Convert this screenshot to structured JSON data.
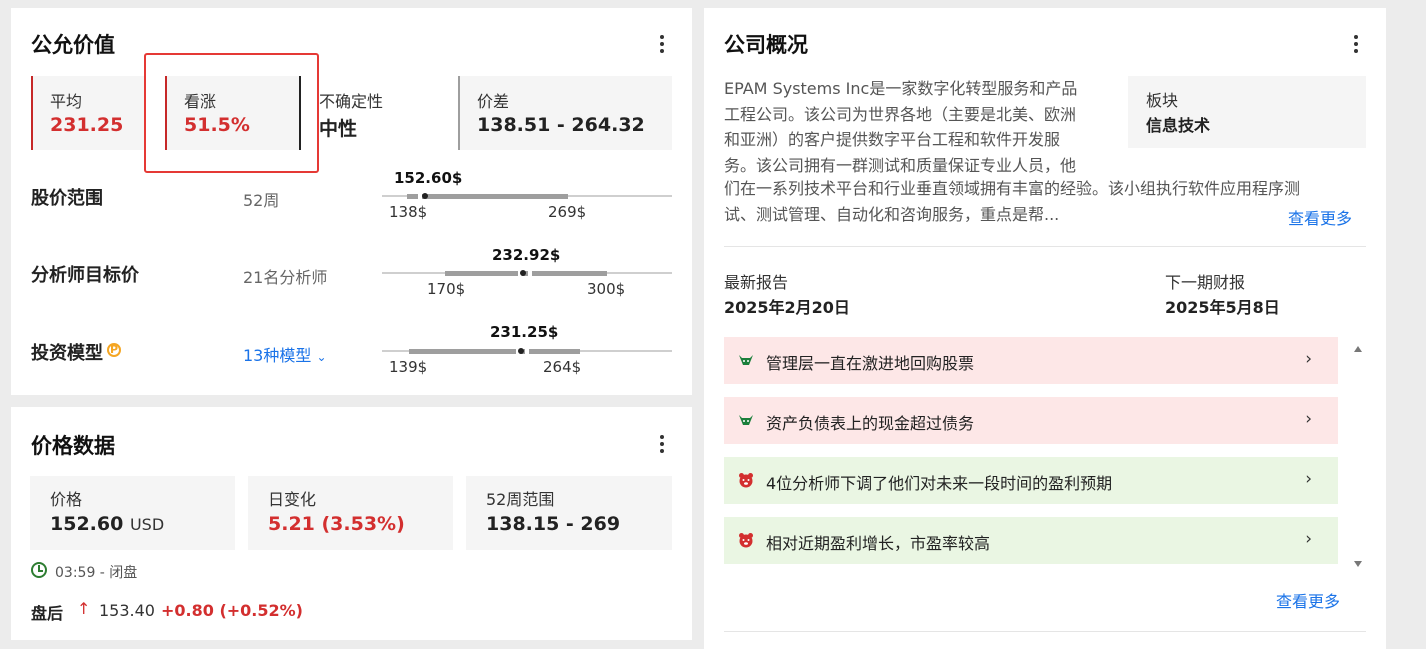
{
  "fair_value": {
    "title": "公允价值",
    "boxes": {
      "average": {
        "label": "平均",
        "value": "231.25"
      },
      "upside": {
        "label": "看涨",
        "value": "51.5%"
      },
      "uncertainty": {
        "label": "不确定性",
        "value": "中性"
      },
      "spread": {
        "label": "价差",
        "value": "138.51 - 264.32"
      }
    },
    "ranges": [
      {
        "title": "股价范围",
        "sub": "52周",
        "current": "152.60$",
        "min": "138$",
        "max": "269$"
      },
      {
        "title": "分析师目标价",
        "sub": "21名分析师",
        "current": "232.92$",
        "min": "170$",
        "max": "300$"
      },
      {
        "title": "投资模型",
        "sub": "13种模型",
        "current": "231.25$",
        "min": "139$",
        "max": "264$"
      }
    ],
    "pro_icon": "P"
  },
  "price_data": {
    "title": "价格数据",
    "price": {
      "label": "价格",
      "value": "152.60",
      "unit": "USD"
    },
    "day_change": {
      "label": "日变化",
      "value": "5.21 (3.53%)"
    },
    "range_52w": {
      "label": "52周范围",
      "value": "138.15 - 269"
    },
    "status": "03:59 - 闭盘",
    "after_hours": {
      "label": "盘后",
      "arrow": "↑",
      "price": "153.40",
      "change": "+0.80 (+0.52%)"
    }
  },
  "company": {
    "title": "公司概况",
    "description_lines": [
      "EPAM Systems Inc是一家数字化转型服务和产品",
      "工程公司。该公司为世界各地（主要是北美、欧洲",
      "和亚洲）的客户提供数字平台工程和软件开发服",
      "务。该公司拥有一群测试和质量保证专业人员，他"
    ],
    "description_full_lines": [
      "们在一系列技术平台和行业垂直领域拥有丰富的经验。该小组执行软件应用程序测",
      "试、测试管理、自动化和咨询服务，重点是帮..."
    ],
    "sector": {
      "label": "板块",
      "value": "信息技术"
    },
    "see_more": "查看更多",
    "latest_report": {
      "label": "最新报告",
      "value": "2025年2月20日"
    },
    "next_report": {
      "label": "下一期财报",
      "value": "2025年5月8日"
    },
    "insights": [
      {
        "type": "bull",
        "text": "管理层一直在激进地回购股票"
      },
      {
        "type": "bull",
        "text": "资产负债表上的现金超过债务"
      },
      {
        "type": "bear",
        "text": "4位分析师下调了他们对未来一段时间的盈利预期"
      },
      {
        "type": "bear",
        "text": "相对近期盈利增长，市盈率较高"
      }
    ],
    "see_more_2": "查看更多"
  },
  "colors": {
    "negative": "#d32f2f",
    "link": "#1a73e8",
    "bull": "#1b7f3b",
    "bear": "#d32f2f"
  }
}
